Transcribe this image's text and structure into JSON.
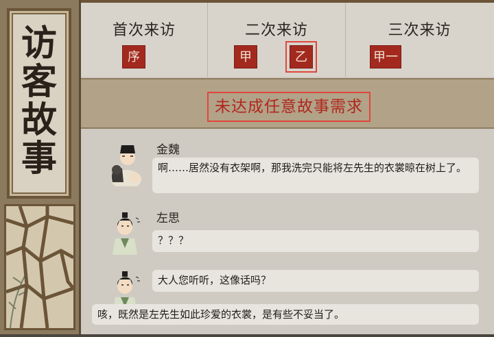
{
  "title": {
    "chars": [
      "访",
      "客",
      "故",
      "事"
    ]
  },
  "visits": [
    {
      "label": "首次来访",
      "tags": [
        "序"
      ]
    },
    {
      "label": "二次来访",
      "tags": [
        "甲",
        "乙"
      ]
    },
    {
      "label": "三次来访",
      "tags": [
        "甲一"
      ]
    }
  ],
  "banner": {
    "text": "未达成任意故事需求"
  },
  "dialogue": [
    {
      "speaker": "金魏",
      "text": "啊……居然没有衣架啊，那我洗完只能将左先生的衣裳晾在树上了。"
    },
    {
      "speaker": "左思",
      "text": "？？？"
    },
    {
      "speaker": "",
      "text": "大人您听听，这像话吗？"
    },
    {
      "speaker": "",
      "text": "咳，既然是左先生如此珍爱的衣裳，是有些不妥当了。"
    }
  ],
  "colors": {
    "accent_red": "#a3291f",
    "highlight": "#e0463b",
    "banner": "#b2a288"
  }
}
